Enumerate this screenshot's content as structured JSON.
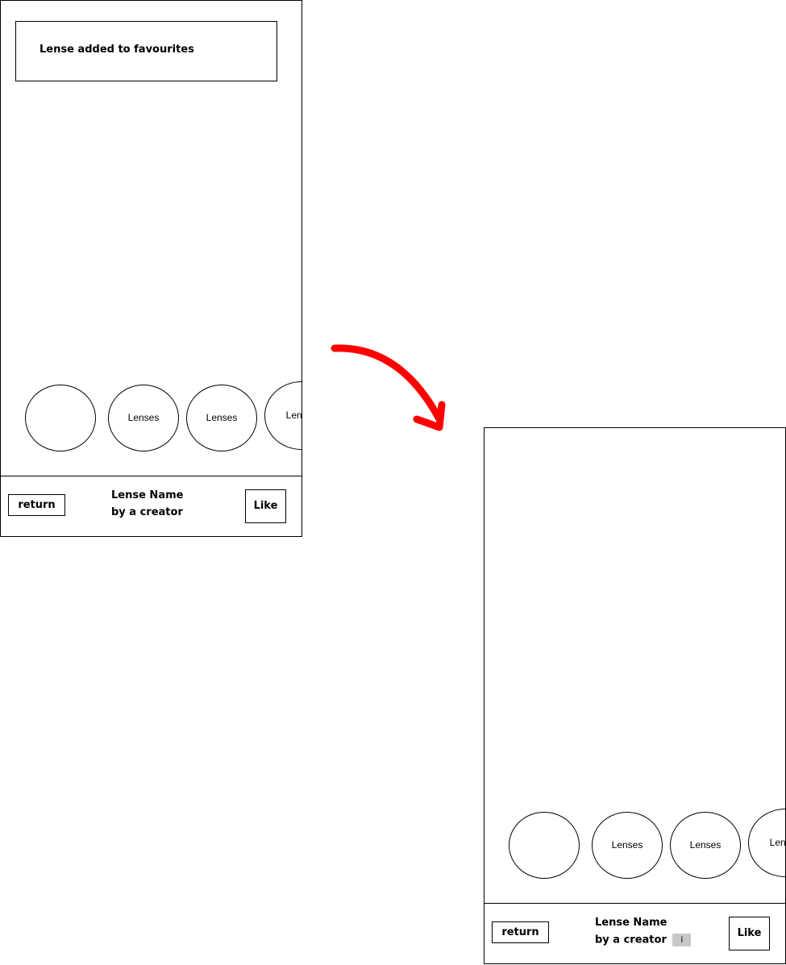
{
  "screen_before": {
    "toast": {
      "text": "Lense added to favourites"
    },
    "lenses": [
      {
        "label": ""
      },
      {
        "label": "Lenses"
      },
      {
        "label": "Lenses"
      },
      {
        "label": "Lenses"
      }
    ],
    "bottom_bar": {
      "return_label": "return",
      "lens_name": "Lense Name",
      "creator": "by a creator",
      "like_label": "Like"
    }
  },
  "screen_after": {
    "lenses": [
      {
        "label": ""
      },
      {
        "label": "Lenses"
      },
      {
        "label": "Lenses"
      },
      {
        "label": "Lenses"
      }
    ],
    "bottom_bar": {
      "return_label": "return",
      "lens_name": "Lense Name",
      "creator": "by a creator",
      "info_badge": "i",
      "like_label": "Like"
    }
  },
  "colors": {
    "arrow": "#ff0000",
    "info_badge_bg": "#c8c8c8",
    "outline": "#000000"
  },
  "icons": {
    "transition": "curved-arrow-icon"
  }
}
